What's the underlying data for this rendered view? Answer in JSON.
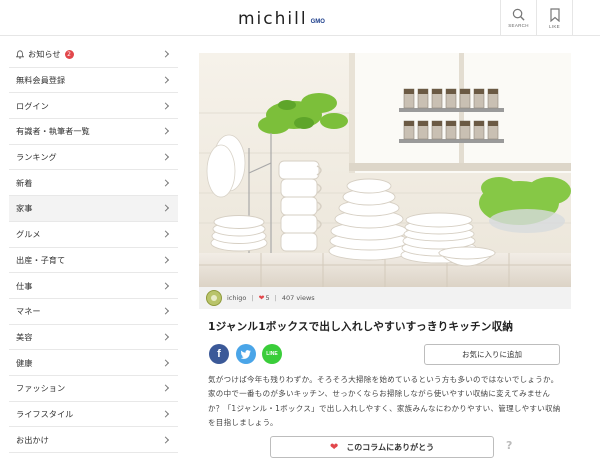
{
  "header": {
    "logo_text": "michill",
    "logo_sub": "GMO",
    "search_label": "SEARCH",
    "like_label": "LIKE"
  },
  "sidebar": {
    "items": [
      {
        "label": "お知らせ",
        "badge": "2"
      },
      {
        "label": "無料会員登録"
      },
      {
        "label": "ログイン"
      },
      {
        "label": "有識者・執筆者一覧"
      },
      {
        "label": "ランキング"
      },
      {
        "label": "新着"
      },
      {
        "label": "家事"
      },
      {
        "label": "グルメ"
      },
      {
        "label": "出産・子育て"
      },
      {
        "label": "仕事"
      },
      {
        "label": "マネー"
      },
      {
        "label": "美容"
      },
      {
        "label": "健康"
      },
      {
        "label": "ファッション"
      },
      {
        "label": "ライフスタイル"
      },
      {
        "label": "お出かけ"
      }
    ]
  },
  "article": {
    "author": "ichigo",
    "likes": "5",
    "views": "407 views",
    "title": "1ジャンル1ボックスで出し入れしやすいすっきりキッチン収納",
    "share": {
      "facebook": "f",
      "twitter": "t",
      "line": "LINE"
    },
    "favorite_label": "お気に入りに追加",
    "body": "気がつけば今年も残りわずか。そろそろ大掃除を始めているという方も多いのではないでしょうか。家の中で一番ものが多いキッチン、せっかくならお掃除しながら使いやすい収納に変えてみませんか？「1ジャンル・1ボックス」で出し入れしやすく、家族みんなにわかりやすい、管理しやすい収納を目指しましょう。",
    "thanks_label": "このコラムにありがとう",
    "help_mark": "?"
  },
  "colors": {
    "accent": "#e2474b",
    "facebook": "#3b5998",
    "twitter": "#4aa5e8",
    "line": "#3acd3a"
  }
}
